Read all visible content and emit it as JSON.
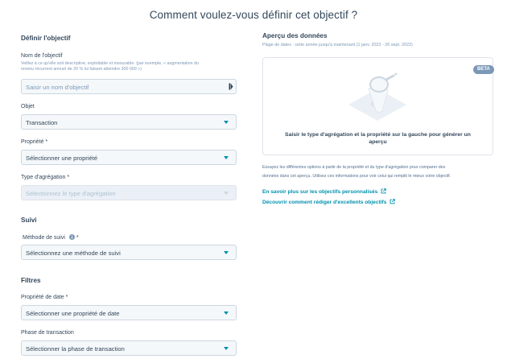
{
  "page_title": "Comment voulez-vous définir cet objectif ?",
  "define": {
    "section_title": "Définir l'objectif",
    "name_label": "Nom de l'objectif",
    "name_help_1": "Veillez à ce qu'elle soit descriptive, exploitable et mesurable. (par exemple, « augmentation du",
    "name_help_2": "revenu récurrent annuel de 20 % lui faisant atteindre 300 000 »)",
    "name_placeholder": "Saisir un nom d'objectif",
    "object_label": "Objet",
    "object_value": "Transaction",
    "property_label": "Propriété *",
    "property_placeholder": "Sélectionner une propriété",
    "aggregation_label": "Type d'agrégation *",
    "aggregation_placeholder": "Sélectionnez le type d'agrégation"
  },
  "tracking": {
    "section_title": "Suivi",
    "method_label": "Méthode de suivi",
    "method_required": "*",
    "method_placeholder": "Sélectionnez une méthode de suivi"
  },
  "filters": {
    "section_title": "Filtres",
    "date_label": "Propriété de date *",
    "date_placeholder": "Sélectionner une propriété de date",
    "stage_label": "Phase de transaction",
    "stage_placeholder": "Sélectionner la phase de transaction"
  },
  "preview": {
    "title": "Aperçu des données",
    "date_range": "Plage de dates : cette année jusqu'à maintenant (1 janv. 2022 - 26 sept. 2022)",
    "badge": "BETA",
    "empty_line_1": "Saisir le type d'agrégation et la propriété sur la gauche pour générer un",
    "empty_line_2": "aperçu",
    "desc_line_1": "Essayez les différentes options à partir de la propriété et du type d'agrégation pour comparer des",
    "desc_line_2": "données dans cet aperçu. Utilisez ces informations pour voir celui qui remplit le mieux votre objectif.",
    "link_1": "En savoir plus sur les objectifs personnalisés",
    "link_2": "Découvrir comment rédiger d'excellents objectifs"
  },
  "colors": {
    "accent": "#0091ae",
    "text": "#33475b",
    "muted": "#7c98b6",
    "border": "#cbd6e2",
    "field_bg": "#f5f8fa"
  }
}
